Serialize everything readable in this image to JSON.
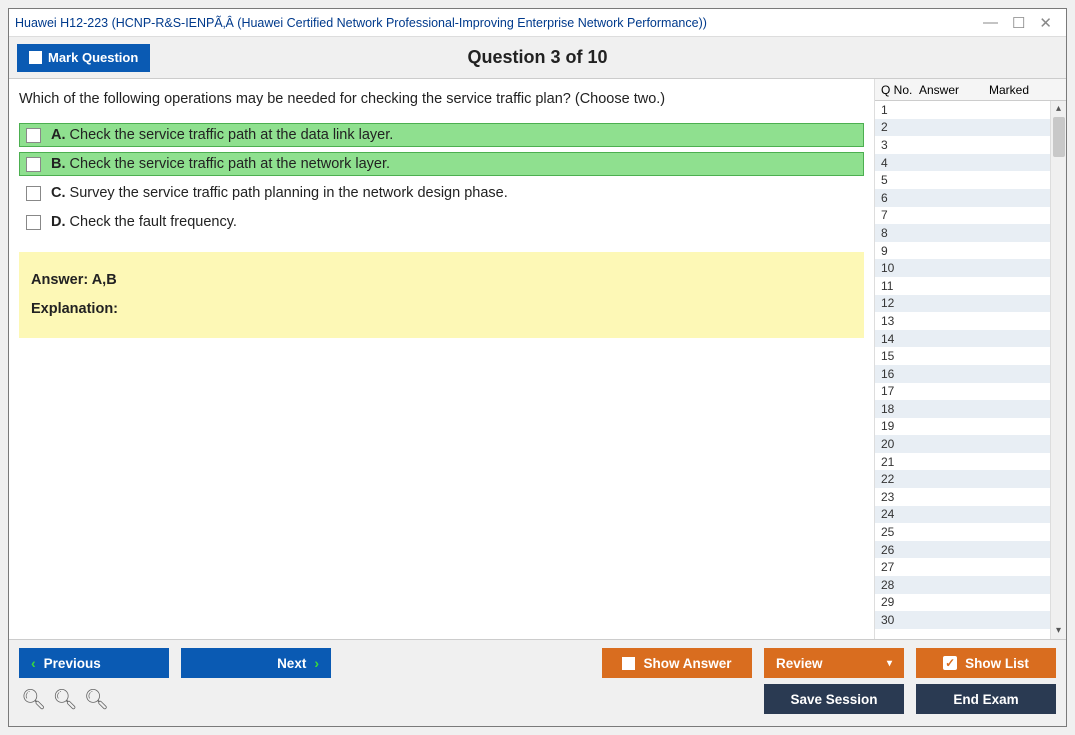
{
  "title": "Huawei H12-223 (HCNP-R&S-IENPÃ‚Â (Huawei Certified Network Professional-Improving Enterprise Network Performance))",
  "header": {
    "mark_label": "Mark Question",
    "counter": "Question 3 of 10"
  },
  "question": {
    "text": "Which of the following operations may be needed for checking the service traffic plan? (Choose two.)",
    "options": [
      {
        "letter": "A.",
        "text": "Check the service traffic path at the data link layer.",
        "selected": true
      },
      {
        "letter": "B.",
        "text": "Check the service traffic path at the network layer.",
        "selected": true
      },
      {
        "letter": "C.",
        "text": "Survey the service traffic path planning in the network design phase.",
        "selected": false
      },
      {
        "letter": "D.",
        "text": "Check the fault frequency.",
        "selected": false
      }
    ],
    "answer_line": "Answer: A,B",
    "explanation_label": "Explanation:"
  },
  "side": {
    "col1": "Q No.",
    "col2": "Answer",
    "col3": "Marked",
    "count": 30
  },
  "footer": {
    "previous": "Previous",
    "next": "Next",
    "show_answer": "Show Answer",
    "review": "Review",
    "show_list": "Show List",
    "save_session": "Save Session",
    "end_exam": "End Exam"
  }
}
